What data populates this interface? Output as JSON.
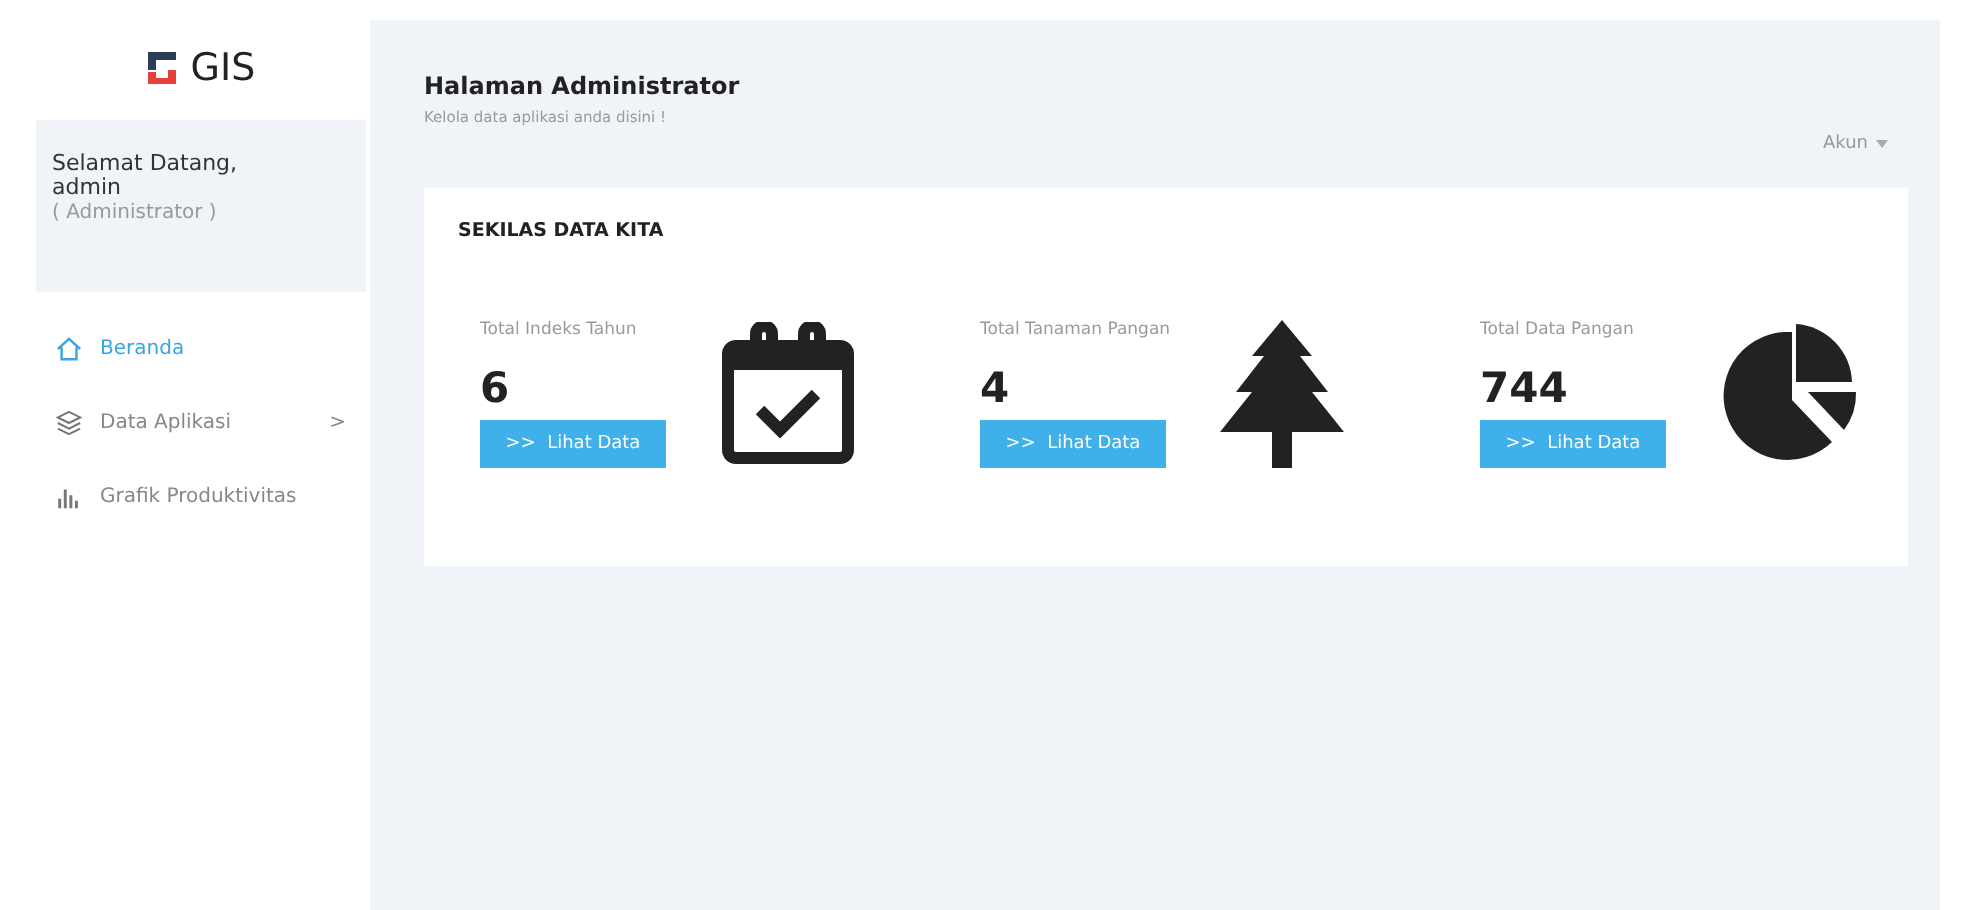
{
  "brand": {
    "name": "GIS"
  },
  "welcome": {
    "greeting": "Selamat Datang,",
    "user": "admin",
    "role": "( Administrator )"
  },
  "menu": [
    {
      "label": "Beranda",
      "kind": "home",
      "selected": true
    },
    {
      "label": "Data Aplikasi",
      "kind": "data",
      "selected": false,
      "arrow": ">"
    },
    {
      "label": "Grafik Produktivitas",
      "kind": "chart",
      "selected": false
    }
  ],
  "header": {
    "title": "Halaman Administrator",
    "subtitle": "Kelola data aplikasi anda disini !",
    "account": "Akun"
  },
  "card": {
    "title": "SEKILAS DATA KITA",
    "stats": [
      {
        "label": "Total Indeks Tahun",
        "value": "6",
        "button": ">>  Lihat Data",
        "kind": "year"
      },
      {
        "label": "Total Tanaman Pangan",
        "value": "4",
        "button": ">>  Lihat Data",
        "kind": "plant"
      },
      {
        "label": "Total Data Pangan",
        "value": "744",
        "button": ">>  Lihat Data",
        "kind": "food"
      }
    ]
  }
}
